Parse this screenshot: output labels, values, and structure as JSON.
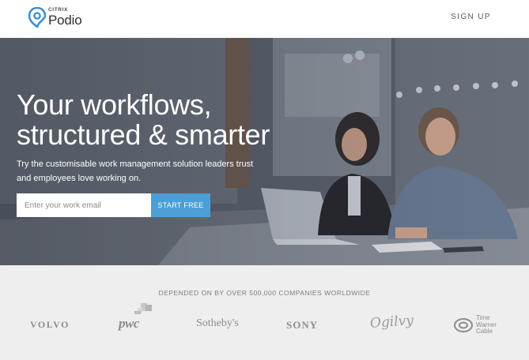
{
  "header": {
    "brand_small": "CITRIX",
    "brand_name": "Podio",
    "signup_label": "SIGN UP"
  },
  "hero": {
    "title_line1": "Your workflows,",
    "title_line2": "structured & smarter",
    "subtitle": "Try the customisable work management solution leaders trust and employees love working on.",
    "email_placeholder": "Enter your work email",
    "cta_label": "START FREE",
    "cta_color": "#4d9ed6"
  },
  "customers": {
    "heading": "DEPENDED ON BY OVER 500,000 COMPANIES WORLDWIDE",
    "logos": [
      {
        "name": "VOLVO"
      },
      {
        "name": "pwc"
      },
      {
        "name": "Sotheby's"
      },
      {
        "name": "SONY"
      },
      {
        "name": "Ogilvy"
      },
      {
        "name": "Time Warner Cable",
        "lines": [
          "Time",
          "Warner",
          "Cable"
        ]
      }
    ]
  },
  "colors": {
    "logo_blue": "#3d8fd1",
    "hero_bg": "#59606c",
    "section_bg": "#eeeeee"
  }
}
